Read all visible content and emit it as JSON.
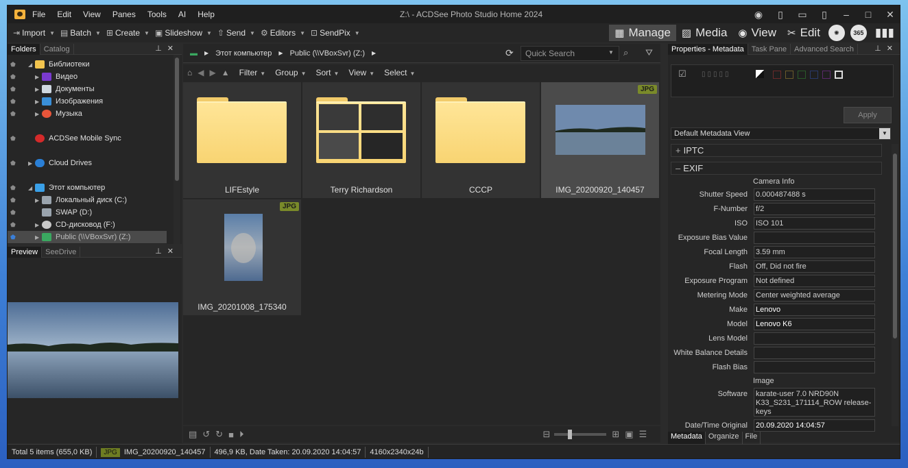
{
  "window": {
    "title": "Z:\\ - ACDSee Photo Studio Home 2024"
  },
  "menu": [
    "File",
    "Edit",
    "View",
    "Panes",
    "Tools",
    "AI",
    "Help"
  ],
  "toolbar": {
    "import": "Import",
    "batch": "Batch",
    "create": "Create",
    "slideshow": "Slideshow",
    "send": "Send",
    "editors": "Editors",
    "sendpix": "SendPix"
  },
  "modes": {
    "manage": "Manage",
    "media": "Media",
    "view": "View",
    "edit": "Edit",
    "badge365": "365"
  },
  "folders_panel": {
    "tabs": [
      "Folders",
      "Catalog"
    ],
    "items": [
      {
        "label": "Библиотеки"
      },
      {
        "label": "Видео"
      },
      {
        "label": "Документы"
      },
      {
        "label": "Изображения"
      },
      {
        "label": "Музыка"
      },
      {
        "label": "ACDSee Mobile Sync"
      },
      {
        "label": "Cloud Drives"
      },
      {
        "label": "Этот компьютер"
      },
      {
        "label": "Локальный диск (C:)"
      },
      {
        "label": "SWAP (D:)"
      },
      {
        "label": "CD-дисковод (F:)"
      },
      {
        "label": "Public (\\\\VBoxSvr) (Z:)"
      }
    ]
  },
  "preview_panel": {
    "tabs": [
      "Preview",
      "SeeDrive"
    ]
  },
  "address": {
    "crumb1": "Этот компьютер",
    "crumb2": "Public (\\\\VBoxSvr) (Z:)",
    "search_placeholder": "Quick Search"
  },
  "navbar": {
    "filter": "Filter",
    "group": "Group",
    "sort": "Sort",
    "view": "View",
    "select": "Select"
  },
  "files": [
    {
      "name": "LIFEstyle",
      "type": "folder"
    },
    {
      "name": "Terry Richardson",
      "type": "folder-photos"
    },
    {
      "name": "CCCP",
      "type": "folder"
    },
    {
      "name": "IMG_20200920_140457",
      "type": "image",
      "badge": "JPG"
    },
    {
      "name": "IMG_20201008_175340",
      "type": "image",
      "badge": "JPG"
    }
  ],
  "status": {
    "total": "Total 5 items  (655,0 KB)",
    "jpg": "JPG",
    "file": "IMG_20200920_140457",
    "info": "496,9 KB, Date Taken: 20.09.2020 14:04:57",
    "dims": "4160x2340x24b"
  },
  "properties": {
    "tabs": [
      "Properties - Metadata",
      "Task Pane",
      "Advanced Search"
    ],
    "apply": "Apply",
    "view_select": "Default Metadata View",
    "section_iptc": "IPTC",
    "section_exif": "EXIF",
    "camera_info": "Camera Info",
    "image_hdr": "Image",
    "rows": [
      {
        "k": "Shutter Speed",
        "v": "0.000487488 s"
      },
      {
        "k": "F-Number",
        "v": "f/2"
      },
      {
        "k": "ISO",
        "v": "ISO 101"
      },
      {
        "k": "Exposure Bias Value",
        "v": ""
      },
      {
        "k": "Focal Length",
        "v": "3.59 mm"
      },
      {
        "k": "Flash",
        "v": "Off, Did not fire"
      },
      {
        "k": "Exposure Program",
        "v": "Not defined"
      },
      {
        "k": "Metering Mode",
        "v": "Center weighted average"
      },
      {
        "k": "Make",
        "v": "Lenovo"
      },
      {
        "k": "Model",
        "v": "Lenovo K6"
      },
      {
        "k": "Lens Model",
        "v": ""
      },
      {
        "k": "White Balance Details",
        "v": ""
      },
      {
        "k": "Flash Bias",
        "v": ""
      }
    ],
    "software_k": "Software",
    "software_v": "karate-user 7.0 NRD90N K33_S231_171114_ROW release-keys",
    "datetime_k": "Date/Time Original",
    "datetime_v": "20.09.2020 14:04:57",
    "bottom_tabs": [
      "Metadata",
      "Organize",
      "File"
    ]
  }
}
